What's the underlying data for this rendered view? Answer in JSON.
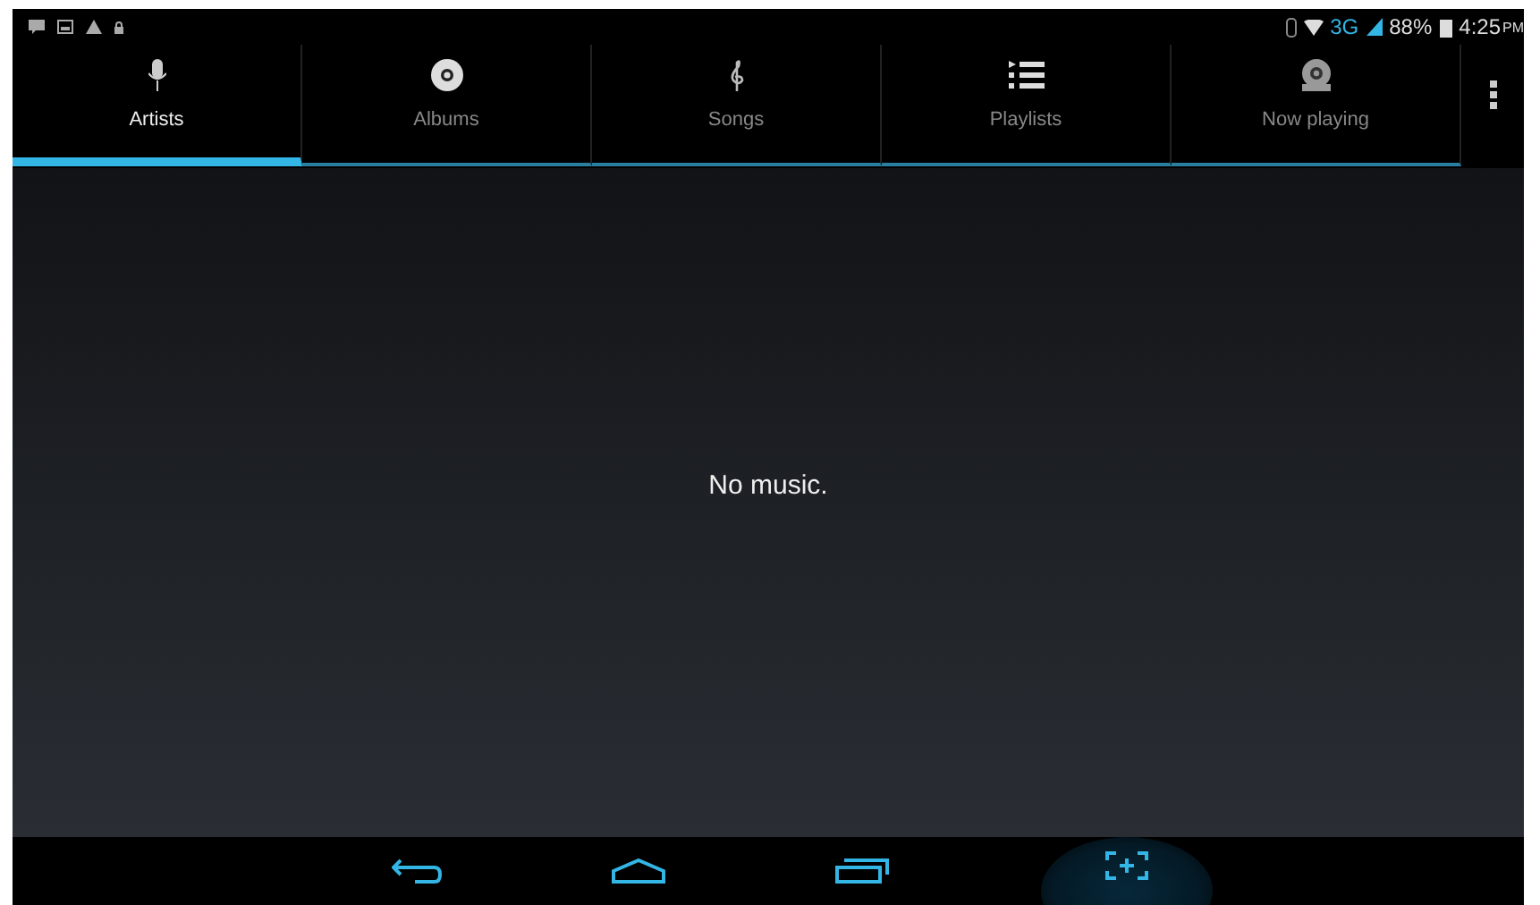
{
  "status_bar": {
    "network": "3G",
    "battery": "88%",
    "time": "4:25",
    "ampm": "PM"
  },
  "tabs": [
    {
      "label": "Artists",
      "kind": "mic",
      "selected": true
    },
    {
      "label": "Albums",
      "kind": "disc",
      "selected": false
    },
    {
      "label": "Songs",
      "kind": "clef",
      "selected": false
    },
    {
      "label": "Playlists",
      "kind": "list",
      "selected": false
    },
    {
      "label": "Now playing",
      "kind": "nowplaying",
      "selected": false
    }
  ],
  "message": "No music."
}
